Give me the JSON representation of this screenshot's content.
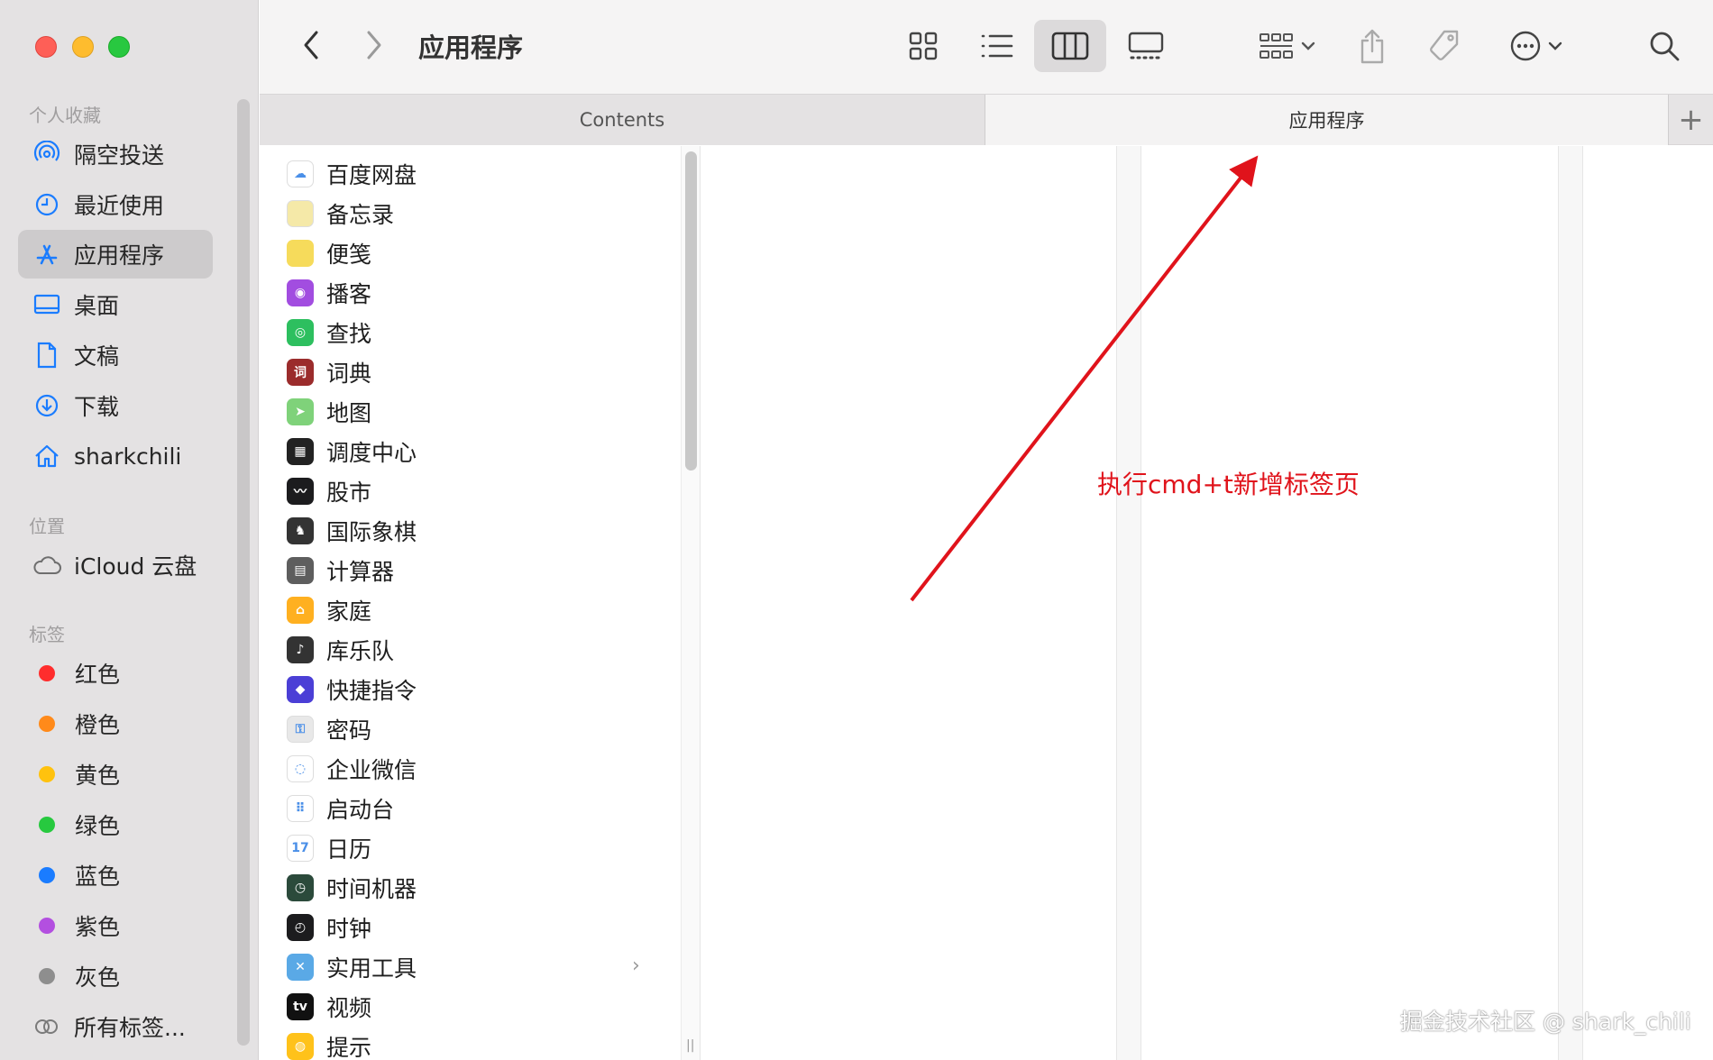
{
  "window": {
    "title": "应用程序"
  },
  "sidebar": {
    "favorites_title": "个人收藏",
    "favorites": [
      {
        "label": "隔空投送",
        "icon": "airdrop-icon"
      },
      {
        "label": "最近使用",
        "icon": "clock-icon"
      },
      {
        "label": "应用程序",
        "icon": "applications-icon",
        "active": true
      },
      {
        "label": "桌面",
        "icon": "desktop-icon"
      },
      {
        "label": "文稿",
        "icon": "document-icon"
      },
      {
        "label": "下载",
        "icon": "download-icon"
      },
      {
        "label": "sharkchili",
        "icon": "home-icon"
      }
    ],
    "locations_title": "位置",
    "locations": [
      {
        "label": "iCloud 云盘",
        "icon": "cloud-icon"
      }
    ],
    "tags_title": "标签",
    "tags": [
      {
        "label": "红色",
        "color": "#ff2d2d"
      },
      {
        "label": "橙色",
        "color": "#ff8a1a"
      },
      {
        "label": "黄色",
        "color": "#ffc20e"
      },
      {
        "label": "绿色",
        "color": "#27c93f"
      },
      {
        "label": "蓝色",
        "color": "#1a7cff"
      },
      {
        "label": "紫色",
        "color": "#b34fe0"
      },
      {
        "label": "灰色",
        "color": "#8e8e8e"
      }
    ],
    "all_tags": "所有标签..."
  },
  "tabs": [
    {
      "label": "Contents",
      "active": false
    },
    {
      "label": "应用程序",
      "active": true
    }
  ],
  "tab_add": "+",
  "apps": [
    {
      "label": "百度网盘",
      "icon_color": "#ffffff",
      "icon_glyph": "☁"
    },
    {
      "label": "备忘录",
      "icon_color": "#f5e9a8",
      "icon_glyph": ""
    },
    {
      "label": "便笺",
      "icon_color": "#f6db5b",
      "icon_glyph": ""
    },
    {
      "label": "播客",
      "icon_color": "#a24de0",
      "icon_glyph": "◉"
    },
    {
      "label": "查找",
      "icon_color": "#2dbf5f",
      "icon_glyph": "◎"
    },
    {
      "label": "词典",
      "icon_color": "#9b2c2c",
      "icon_glyph": "词"
    },
    {
      "label": "地图",
      "icon_color": "#7fd27a",
      "icon_glyph": "➤"
    },
    {
      "label": "调度中心",
      "icon_color": "#222222",
      "icon_glyph": "▦"
    },
    {
      "label": "股市",
      "icon_color": "#1c1c1e",
      "icon_glyph": "〰"
    },
    {
      "label": "国际象棋",
      "icon_color": "#333333",
      "icon_glyph": "♞"
    },
    {
      "label": "计算器",
      "icon_color": "#5e5e5e",
      "icon_glyph": "▤"
    },
    {
      "label": "家庭",
      "icon_color": "#ffb020",
      "icon_glyph": "⌂"
    },
    {
      "label": "库乐队",
      "icon_color": "#333333",
      "icon_glyph": "♪"
    },
    {
      "label": "快捷指令",
      "icon_color": "#4b3fd6",
      "icon_glyph": "◆"
    },
    {
      "label": "密码",
      "icon_color": "#e8e8e8",
      "icon_glyph": "⚿"
    },
    {
      "label": "企业微信",
      "icon_color": "#ffffff",
      "icon_glyph": "◌"
    },
    {
      "label": "启动台",
      "icon_color": "#ffffff",
      "icon_glyph": "⠿"
    },
    {
      "label": "日历",
      "icon_color": "#ffffff",
      "icon_glyph": "17"
    },
    {
      "label": "时间机器",
      "icon_color": "#2b4a3b",
      "icon_glyph": "◷"
    },
    {
      "label": "时钟",
      "icon_color": "#1c1c1e",
      "icon_glyph": "◴"
    },
    {
      "label": "实用工具",
      "icon_color": "#5aa9e6",
      "icon_glyph": "✕",
      "has_children": true
    },
    {
      "label": "视频",
      "icon_color": "#111111",
      "icon_glyph": "tv"
    },
    {
      "label": "提示",
      "icon_color": "#ffc21a",
      "icon_glyph": "◍"
    }
  ],
  "annotation": "执行cmd+t新增标签页",
  "watermark": "掘金技术社区 @ shark_chili"
}
